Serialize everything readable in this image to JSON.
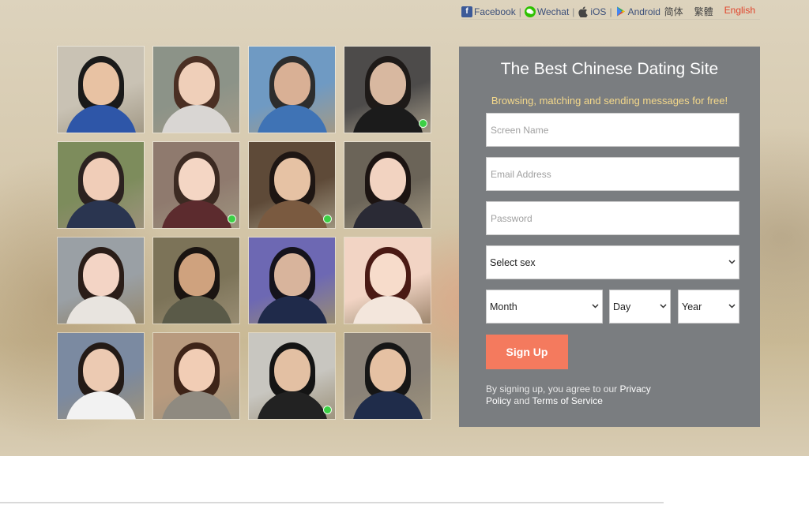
{
  "topnav": {
    "social": [
      {
        "label": "Facebook",
        "icon": "facebook-icon"
      },
      {
        "label": "Wechat",
        "icon": "wechat-icon"
      },
      {
        "label": "iOS",
        "icon": "apple-icon"
      },
      {
        "label": "Android",
        "icon": "android-icon"
      }
    ],
    "separator": "|",
    "languages": [
      {
        "label": "简体",
        "active": false
      },
      {
        "label": "繁體",
        "active": false
      },
      {
        "label": "English",
        "active": true
      }
    ]
  },
  "signup": {
    "title": "The Best Chinese Dating Site",
    "subtitle": "Browsing, matching and sending messages for free!",
    "screen_name_placeholder": "Screen Name",
    "email_placeholder": "Email Address",
    "password_placeholder": "Password",
    "sex_select": "Select sex",
    "month_select": "Month",
    "day_select": "Day",
    "year_select": "Year",
    "button_label": "Sign Up",
    "terms_prefix": "By signing up, you agree to our",
    "privacy_link": "Privacy Policy",
    "terms_and": "and",
    "terms_link": "Terms of Service"
  },
  "colors": {
    "panel_bg": "#7a7d80",
    "subtitle": "#f5d98b",
    "button": "#f47a5e",
    "active_lang": "#e0442c",
    "online_dot": "#3ccf45"
  },
  "profiles": [
    {
      "online": false,
      "bg": "#c9c2b4",
      "hair": "#1a1a1a",
      "skin": "#e8c2a3",
      "shirt": "#2e56a8"
    },
    {
      "online": false,
      "bg": "#8c9388",
      "hair": "#4a2f23",
      "skin": "#efcfb9",
      "shirt": "#d9d6d3"
    },
    {
      "online": false,
      "bg": "#6f9ac3",
      "hair": "#2d2d2d",
      "skin": "#d9b095",
      "shirt": "#3f73b5"
    },
    {
      "online": true,
      "bg": "#4d4b4a",
      "hair": "#1e1a18",
      "skin": "#d8b8a0",
      "shirt": "#1b1b1b"
    },
    {
      "online": false,
      "bg": "#7d8c5c",
      "hair": "#2b2220",
      "skin": "#f0cdb8",
      "shirt": "#2a3550"
    },
    {
      "online": true,
      "bg": "#8f7a6e",
      "hair": "#3c2a22",
      "skin": "#f4d6c4",
      "shirt": "#5c2b2e"
    },
    {
      "online": true,
      "bg": "#5e4a38",
      "hair": "#1e1613",
      "skin": "#e6c2a4",
      "shirt": "#7a5a40"
    },
    {
      "online": false,
      "bg": "#6b6458",
      "hair": "#1c1412",
      "skin": "#f2d3c1",
      "shirt": "#2a2a35"
    },
    {
      "online": false,
      "bg": "#9aa0a5",
      "hair": "#2a1d18",
      "skin": "#f3d4c5",
      "shirt": "#e8e4df"
    },
    {
      "online": false,
      "bg": "#7c7358",
      "hair": "#1a1411",
      "skin": "#cfa27e",
      "shirt": "#5a5a48"
    },
    {
      "online": false,
      "bg": "#6d68b3",
      "hair": "#15131c",
      "skin": "#d8b49c",
      "shirt": "#1f2a4a"
    },
    {
      "online": false,
      "bg": "#f2d4c4",
      "hair": "#4a1a14",
      "skin": "#f7dccb",
      "shirt": "#f3e6dc"
    },
    {
      "online": false,
      "bg": "#7b8aa1",
      "hair": "#231a16",
      "skin": "#eccab2",
      "shirt": "#f2f2f2"
    },
    {
      "online": false,
      "bg": "#b89a7e",
      "hair": "#3e2418",
      "skin": "#f1cdb5",
      "shirt": "#8f8a80"
    },
    {
      "online": true,
      "bg": "#c8c6c0",
      "hair": "#141414",
      "skin": "#e3c0a3",
      "shirt": "#222222"
    },
    {
      "online": false,
      "bg": "#8a8278",
      "hair": "#161616",
      "skin": "#e5c1a3",
      "shirt": "#1f2c4a"
    }
  ]
}
